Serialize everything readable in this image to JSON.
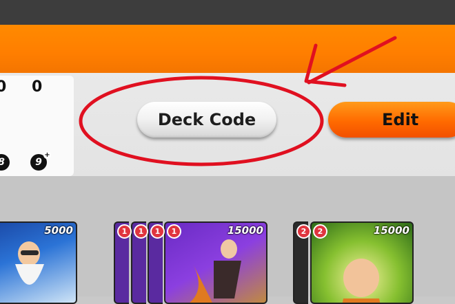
{
  "stats": {
    "top_values": [
      "0",
      "0"
    ],
    "badges": [
      "8",
      "9"
    ],
    "badge_plus": "+"
  },
  "buttons": {
    "deck_code_label": "Deck Code",
    "edit_label": "Edit"
  },
  "cards": [
    {
      "power": "5000",
      "costs": []
    },
    {
      "power": "15000",
      "costs": [
        "1",
        "1",
        "1",
        "1"
      ]
    },
    {
      "power": "15000",
      "costs": [
        "2",
        "2"
      ]
    }
  ],
  "colors": {
    "accent": "#ff7e00",
    "annotation": "#e01020"
  }
}
